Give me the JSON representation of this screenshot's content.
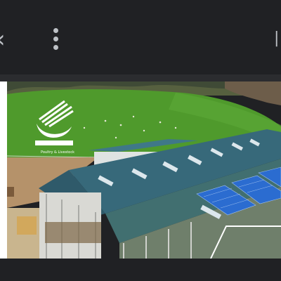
{
  "toolbar": {
    "back_icon": "back-chevron-icon",
    "menu_icon": "more-vertical-icon",
    "share_icon": "share-icon"
  },
  "image": {
    "logo": {
      "name": "company-logo",
      "text": "Poultry & Livestock",
      "colors": {
        "mark": "#ffffff"
      }
    },
    "colors": {
      "grass": "#4f9a2c",
      "roof": "#3b6d7a",
      "solar": "#2b6cd0",
      "soil": "#b5926a"
    }
  }
}
